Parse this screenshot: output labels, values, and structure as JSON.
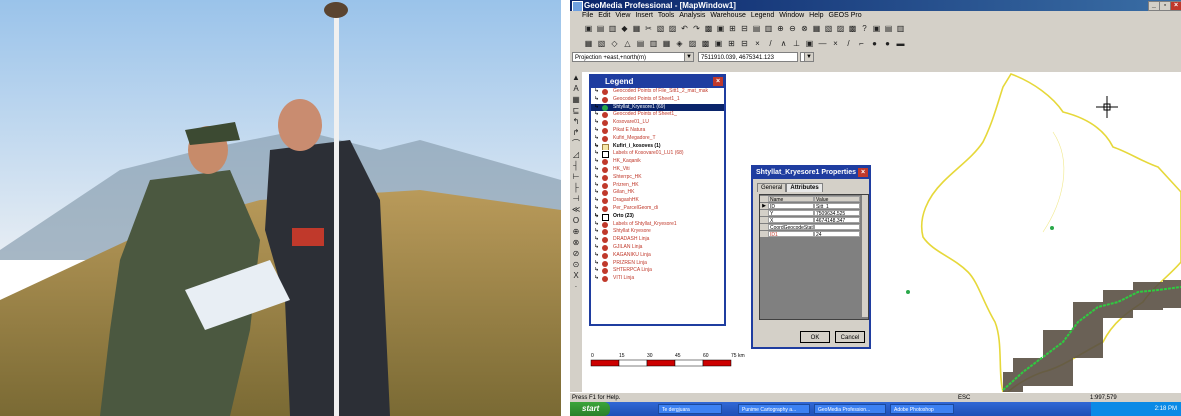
{
  "window": {
    "title": "GeoMedia Professional - [MapWindow1]"
  },
  "menu": [
    "File",
    "Edit",
    "View",
    "Insert",
    "Tools",
    "Analysis",
    "Warehouse",
    "Legend",
    "Window",
    "Help",
    "GEOS Pro"
  ],
  "toolbar": {
    "projection_select": "Projection +east,+north(m)",
    "coordinate_readout": "7511910.039, 4675341.123"
  },
  "legend": {
    "title": "Legend",
    "items": [
      {
        "label": "Geocoded Points of File_Sitt1_2_mat_mak",
        "style": "red"
      },
      {
        "label": "Geocoded Points of Sheet1_1",
        "style": "red"
      },
      {
        "label": "Shtyllat_Kryesore1 (69)",
        "style": "green",
        "highlighted": true
      },
      {
        "label": "Geocoded Points of Sheet1_",
        "style": "red"
      },
      {
        "label": "Kosovare01_LU",
        "style": "red"
      },
      {
        "label": "Pikat E Natura",
        "style": "red"
      },
      {
        "label": "Kufiri_Megadore_T",
        "style": "red"
      },
      {
        "label": "Kufiri_i_kosoves  (1)",
        "style": "box",
        "black": true
      },
      {
        "label": "Labels of Kosovare01_LU1 (68)",
        "style": "A"
      },
      {
        "label": "HK_Kaqanik",
        "style": "red"
      },
      {
        "label": "HK_Viti",
        "style": "red"
      },
      {
        "label": "Shterrpc_HK",
        "style": "red"
      },
      {
        "label": "Prizren_HK",
        "style": "red"
      },
      {
        "label": "Gilan_HK",
        "style": "red"
      },
      {
        "label": "DragashHK",
        "style": "red"
      },
      {
        "label": "Per_ParcelGeom_di",
        "style": "red"
      },
      {
        "label": "Orto (23)",
        "style": "grid",
        "black": true
      },
      {
        "label": "Labels of Shtyllat_Kryesore1",
        "style": "red"
      },
      {
        "label": "Shtyllat Kryesore",
        "style": "red"
      },
      {
        "label": "DRADASH Linja",
        "style": "red"
      },
      {
        "label": "GJILAN Linja",
        "style": "red"
      },
      {
        "label": "KAGANIKU Linja",
        "style": "red"
      },
      {
        "label": "PRIZREN Linja",
        "style": "red"
      },
      {
        "label": "SHTERPCA Linja",
        "style": "red"
      },
      {
        "label": "VITI Linja",
        "style": "red"
      }
    ]
  },
  "properties_dialog": {
    "title": "Shtyllat_Kryesore1 Properties",
    "tabs": [
      "General",
      "Attributes"
    ],
    "headers": {
      "name": "Name",
      "value": "Value"
    },
    "rows": [
      {
        "name": "ID",
        "value": "Sitt_1"
      },
      {
        "name": "Y",
        "value": "7509634.525"
      },
      {
        "name": "X",
        "value": "4674148.347"
      },
      {
        "name": "CoordGeocodeStatu",
        "value": ""
      },
      {
        "name": "ID1",
        "value": "24"
      }
    ],
    "ok": "OK",
    "cancel": "Cancel"
  },
  "scale": {
    "ticks": [
      "0",
      "15",
      "30",
      "45",
      "60",
      "75 km"
    ]
  },
  "status": {
    "help": "Press F1 for Help.",
    "esc": "ESC",
    "scale": "1:997,579"
  },
  "taskbar": {
    "start": "start",
    "tasks": [
      "Te dergjuara",
      "Punime Cartography a...",
      "GeoMedia Profession...",
      "Adobe Photoshop"
    ],
    "clock": "2:18 PM"
  },
  "colors": {
    "title": "#0a246a",
    "legend_text": "#c0392b",
    "boundary": "#e6d83a",
    "green_line": "#2ecc40"
  }
}
